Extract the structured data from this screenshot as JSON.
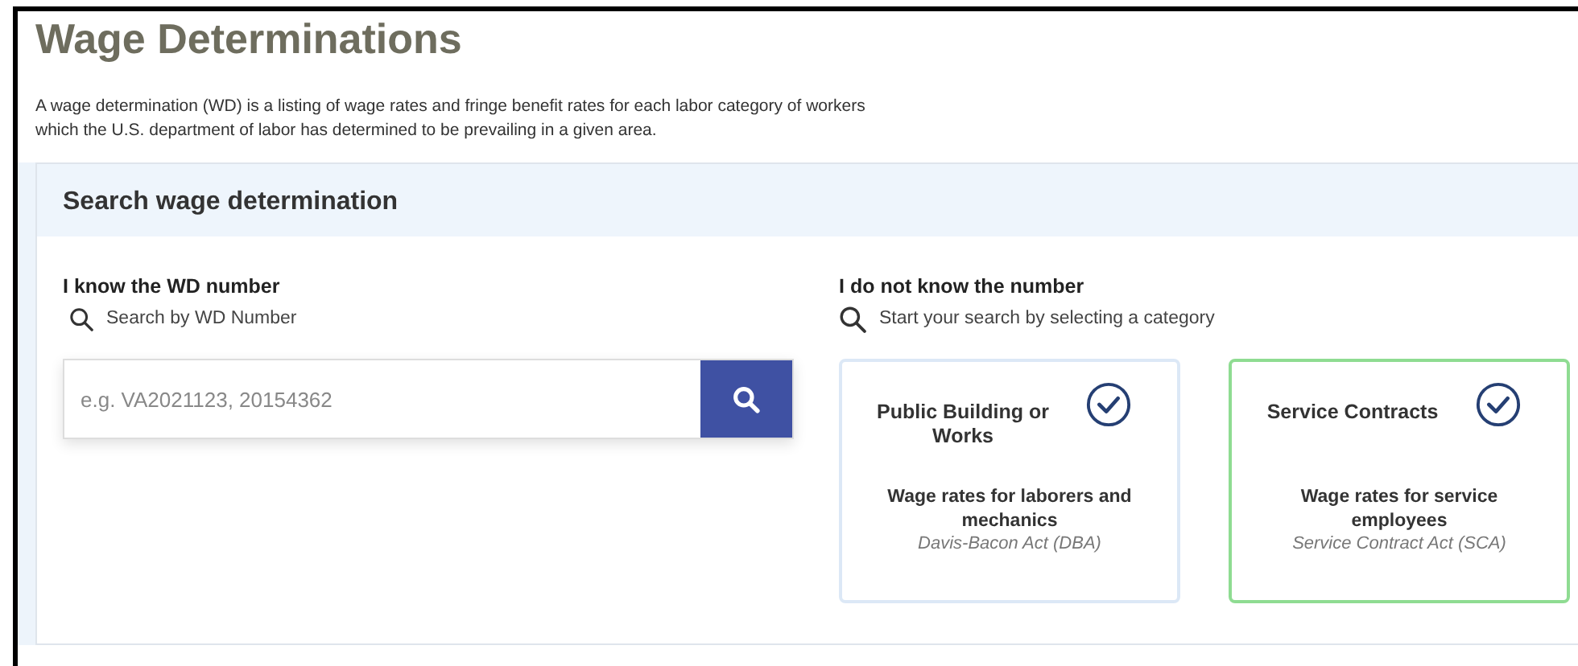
{
  "page": {
    "title": "Wage Determinations",
    "description": "A wage determination (WD) is a listing of wage rates and fringe benefit rates for each labor category of workers which the U.S. department of labor has determined to be prevailing in a given area."
  },
  "search_panel": {
    "title": "Search wage determination",
    "known": {
      "heading": "I know the WD number",
      "hint": "Search by WD Number",
      "placeholder": "e.g. VA2021123, 20154362"
    },
    "unknown": {
      "heading": "I do not know the number",
      "hint": "Start your search by selecting a category",
      "categories": [
        {
          "title": "Public Building or Works",
          "description": "Wage rates for laborers and mechanics",
          "act": "Davis-Bacon Act (DBA)",
          "selected": false
        },
        {
          "title": "Service Contracts",
          "description": "Wage rates for service employees",
          "act": "Service Contract Act (SCA)",
          "selected": true
        }
      ]
    }
  }
}
